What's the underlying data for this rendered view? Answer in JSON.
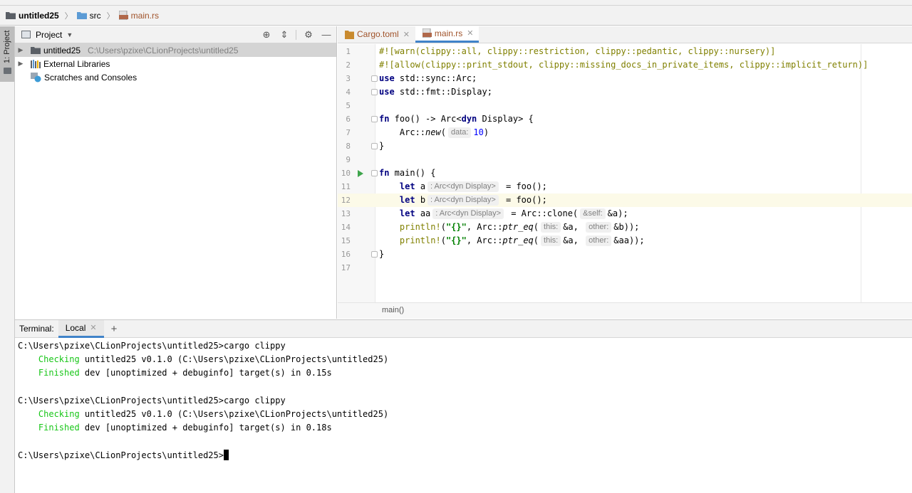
{
  "breadcrumb": {
    "items": [
      "untitled25",
      "src",
      "main.rs"
    ]
  },
  "toolstrip": {
    "project_tab_label": "1: Project"
  },
  "project_panel": {
    "title": "Project",
    "tree": [
      {
        "label": "untitled25",
        "path": "C:\\Users\\pzixe\\CLionProjects\\untitled25"
      },
      {
        "label": "External Libraries"
      },
      {
        "label": "Scratches and Consoles"
      }
    ]
  },
  "editor": {
    "tabs": [
      {
        "label": "Cargo.toml"
      },
      {
        "label": "main.rs"
      }
    ],
    "line_numbers": [
      "1",
      "2",
      "3",
      "4",
      "5",
      "6",
      "7",
      "8",
      "9",
      "10",
      "11",
      "12",
      "13",
      "14",
      "15",
      "16",
      "17"
    ],
    "code": {
      "l1": "#![warn(clippy::all, clippy::restriction, clippy::pedantic, clippy::nursery)]",
      "l2": "#![allow(clippy::print_stdout, clippy::missing_docs_in_private_items, clippy::implicit_return)]",
      "l3_kw": "use",
      "l3_rest": " std::sync::Arc;",
      "l4_kw": "use",
      "l4_rest": " std::fmt::Display;",
      "l6_kw": "fn",
      "l6_a": " foo() -> Arc<",
      "l6_dyn": "dyn",
      "l6_b": " Display> {",
      "l7_a": "    Arc::",
      "l7_fn": "new",
      "l7_b": "(",
      "l7_hint": "data:",
      "l7_num": "10",
      "l7_c": ")",
      "l8": "}",
      "l10_kw": "fn",
      "l10_rest": " main() {",
      "l11_kw": "let",
      "l11_var": " a",
      "l11_hint": ": Arc<dyn Display>",
      "l11_rest": " = foo();",
      "l12_kw": "let",
      "l12_var": " b",
      "l12_hint": ": Arc<dyn Display>",
      "l12_rest": " = foo();",
      "l13_kw": "let",
      "l13_var": " aa",
      "l13_hint": ": Arc<dyn Display>",
      "l13_rest": " = Arc::clone(",
      "l13_hint2": "&self:",
      "l13_end": "&a);",
      "l14_mac": "println!",
      "l14_a": "(",
      "l14_str": "\"{}\"",
      "l14_b": ", Arc::",
      "l14_fn": "ptr_eq",
      "l14_c": "(",
      "l14_h1": "this:",
      "l14_d": "&a,",
      "l14_h2": "other:",
      "l14_e": "&b));",
      "l15_mac": "println!",
      "l15_a": "(",
      "l15_str": "\"{}\"",
      "l15_b": ", Arc::",
      "l15_fn": "ptr_eq",
      "l15_c": "(",
      "l15_h1": "this:",
      "l15_d": "&a,",
      "l15_h2": "other:",
      "l15_e": "&aa));",
      "l16": "}"
    },
    "breadcrumb": "main()"
  },
  "terminal": {
    "label": "Terminal:",
    "tab": "Local",
    "add": "+",
    "lines": {
      "t1": "C:\\Users\\pzixe\\CLionProjects\\untitled25>cargo clippy",
      "t2_g": "    Checking",
      "t2_rest": " untitled25 v0.1.0 (C:\\Users\\pzixe\\CLionProjects\\untitled25)",
      "t3_g": "    Finished",
      "t3_rest": " dev [unoptimized + debuginfo] target(s) in 0.15s",
      "t5": "C:\\Users\\pzixe\\CLionProjects\\untitled25>cargo clippy",
      "t6_g": "    Checking",
      "t6_rest": " untitled25 v0.1.0 (C:\\Users\\pzixe\\CLionProjects\\untitled25)",
      "t7_g": "    Finished",
      "t7_rest": " dev [unoptimized + debuginfo] target(s) in 0.18s",
      "t9": "C:\\Users\\pzixe\\CLionProjects\\untitled25>"
    }
  },
  "colors": {
    "keyword": "#000080",
    "attribute": "#808000",
    "string": "#008000",
    "number": "#0000ff",
    "terminal_green": "#17c617",
    "tab_underline": "#4083c9",
    "current_line": "#fcfae8"
  },
  "icons": [
    "folder-icon",
    "rust-file-icon",
    "target-icon",
    "collapse-all-icon",
    "gear-icon",
    "minimize-icon",
    "run-icon",
    "library-icon",
    "scratches-icon"
  ]
}
